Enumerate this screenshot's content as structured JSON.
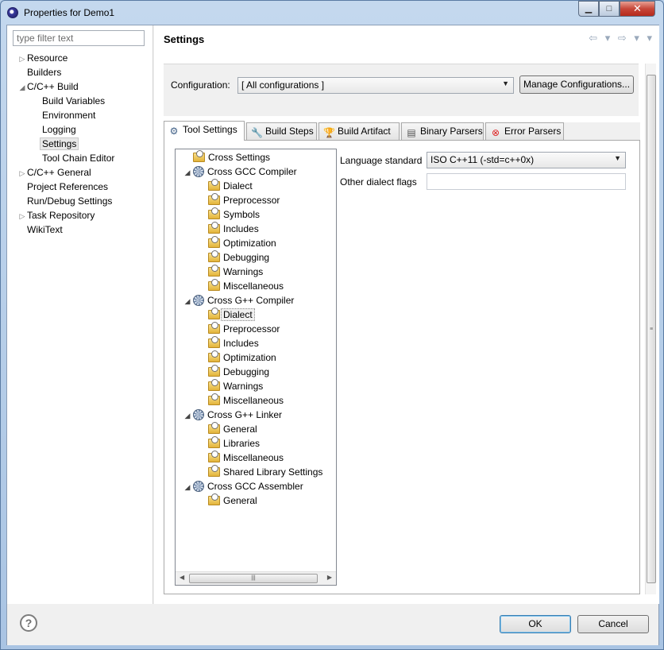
{
  "window": {
    "title": "Properties for Demo1",
    "minimize": "▁",
    "maximize": "□",
    "close": "✕"
  },
  "sidebar": {
    "filter_placeholder": "type filter text",
    "items": [
      {
        "label": "Resource",
        "arrow": "▷"
      },
      {
        "label": "Builders",
        "arrow": ""
      },
      {
        "label": "C/C++ Build",
        "arrow": "◢"
      },
      {
        "label": "Build Variables",
        "arrow": ""
      },
      {
        "label": "Environment",
        "arrow": ""
      },
      {
        "label": "Logging",
        "arrow": ""
      },
      {
        "label": "Settings",
        "arrow": "",
        "selected": true
      },
      {
        "label": "Tool Chain Editor",
        "arrow": ""
      },
      {
        "label": "C/C++ General",
        "arrow": "▷"
      },
      {
        "label": "Project References",
        "arrow": ""
      },
      {
        "label": "Run/Debug Settings",
        "arrow": ""
      },
      {
        "label": "Task Repository",
        "arrow": "▷"
      },
      {
        "label": "WikiText",
        "arrow": ""
      }
    ]
  },
  "main": {
    "title": "Settings",
    "nav_arrows": "⇦ ▾ ⇨ ▾ ▾",
    "configuration_label": "Configuration:",
    "configuration_value": "[ All configurations ]",
    "manage_button": "Manage Configurations...",
    "tabs": [
      {
        "label": "Tool Settings",
        "icon": "gear-icon",
        "active": true
      },
      {
        "label": "Build Steps",
        "icon": "wrench-icon"
      },
      {
        "label": "Build Artifact",
        "icon": "trophy-icon"
      },
      {
        "label": "Binary Parsers",
        "icon": "binary-icon"
      },
      {
        "label": "Error Parsers",
        "icon": "error-icon"
      }
    ],
    "tree": [
      {
        "label": "Cross Settings",
        "level": 1,
        "type": "folder",
        "exp": ""
      },
      {
        "label": "Cross GCC Compiler",
        "level": 0,
        "type": "tool",
        "exp": "◢"
      },
      {
        "label": "Dialect",
        "level": 2,
        "type": "folder",
        "exp": ""
      },
      {
        "label": "Preprocessor",
        "level": 2,
        "type": "folder",
        "exp": ""
      },
      {
        "label": "Symbols",
        "level": 2,
        "type": "folder",
        "exp": ""
      },
      {
        "label": "Includes",
        "level": 2,
        "type": "folder",
        "exp": ""
      },
      {
        "label": "Optimization",
        "level": 2,
        "type": "folder",
        "exp": ""
      },
      {
        "label": "Debugging",
        "level": 2,
        "type": "folder",
        "exp": ""
      },
      {
        "label": "Warnings",
        "level": 2,
        "type": "folder",
        "exp": ""
      },
      {
        "label": "Miscellaneous",
        "level": 2,
        "type": "folder",
        "exp": ""
      },
      {
        "label": "Cross G++ Compiler",
        "level": 0,
        "type": "tool",
        "exp": "◢"
      },
      {
        "label": "Dialect",
        "level": 2,
        "type": "folder",
        "exp": "",
        "selected": true
      },
      {
        "label": "Preprocessor",
        "level": 2,
        "type": "folder",
        "exp": ""
      },
      {
        "label": "Includes",
        "level": 2,
        "type": "folder",
        "exp": ""
      },
      {
        "label": "Optimization",
        "level": 2,
        "type": "folder",
        "exp": ""
      },
      {
        "label": "Debugging",
        "level": 2,
        "type": "folder",
        "exp": ""
      },
      {
        "label": "Warnings",
        "level": 2,
        "type": "folder",
        "exp": ""
      },
      {
        "label": "Miscellaneous",
        "level": 2,
        "type": "folder",
        "exp": ""
      },
      {
        "label": "Cross G++ Linker",
        "level": 0,
        "type": "tool",
        "exp": "◢"
      },
      {
        "label": "General",
        "level": 2,
        "type": "folder",
        "exp": ""
      },
      {
        "label": "Libraries",
        "level": 2,
        "type": "folder",
        "exp": ""
      },
      {
        "label": "Miscellaneous",
        "level": 2,
        "type": "folder",
        "exp": ""
      },
      {
        "label": "Shared Library Settings",
        "level": 2,
        "type": "folder",
        "exp": ""
      },
      {
        "label": "Cross GCC Assembler",
        "level": 0,
        "type": "tool",
        "exp": "◢"
      },
      {
        "label": "General",
        "level": 2,
        "type": "folder",
        "exp": ""
      }
    ],
    "options": {
      "language_standard_label": "Language standard",
      "language_standard_value": "ISO C++11 (-std=c++0x)",
      "other_dialect_label": "Other dialect flags",
      "other_dialect_value": ""
    }
  },
  "footer": {
    "help": "?",
    "ok": "OK",
    "cancel": "Cancel"
  }
}
